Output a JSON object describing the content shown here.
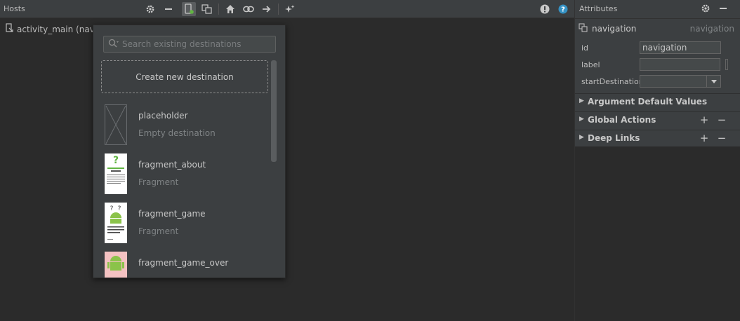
{
  "toolbar": {
    "title": "Hosts",
    "icons": [
      "gear-icon",
      "minus-icon",
      "new-destination-icon",
      "nested-graph-icon",
      "home-icon",
      "link-icon",
      "arrow-right-icon",
      "auto-arrange-icon",
      "warning-icon",
      "help-icon"
    ]
  },
  "hosts": {
    "items": [
      {
        "label": "activity_main (navH"
      }
    ]
  },
  "popup": {
    "search_placeholder": "Search existing destinations",
    "create_label": "Create new destination",
    "destinations": [
      {
        "name": "placeholder",
        "type": "Empty destination"
      },
      {
        "name": "fragment_about",
        "type": "Fragment"
      },
      {
        "name": "fragment_game",
        "type": "Fragment"
      },
      {
        "name": "fragment_game_over",
        "type": ""
      }
    ]
  },
  "attributes": {
    "title": "Attributes",
    "element_name": "navigation",
    "element_type": "navigation",
    "fields": {
      "id_label": "id",
      "id_value": "navigation",
      "label_label": "label",
      "label_value": "",
      "start_label": "startDestination",
      "start_value": ""
    },
    "sections": {
      "args": "Argument Default Values",
      "actions": "Global Actions",
      "deeplinks": "Deep Links"
    }
  },
  "colors": {
    "panel": "#3c3f41",
    "background": "#2b2b2b",
    "help": "#3592c4",
    "android_green": "#8bc34a"
  }
}
